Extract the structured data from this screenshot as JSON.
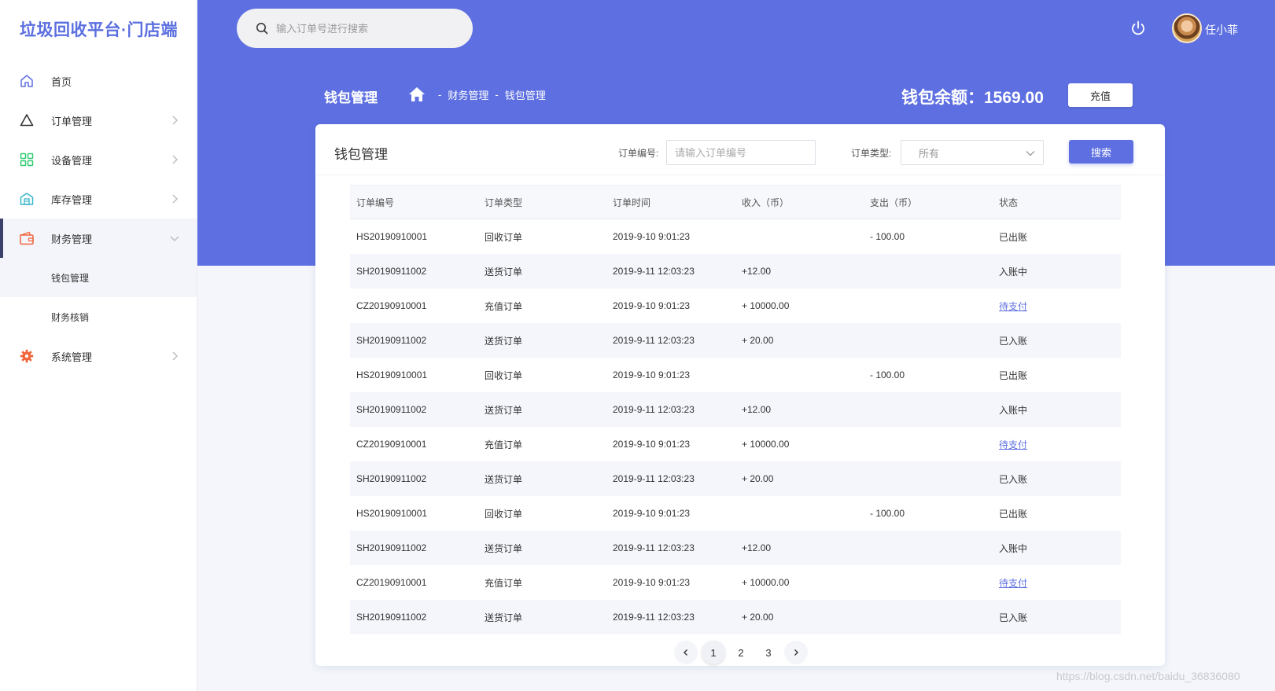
{
  "app": {
    "logo": "垃圾回收平台·门店端"
  },
  "sidebar": {
    "items": [
      {
        "label": "首页",
        "icon": "home-icon",
        "color": "#5e70e1"
      },
      {
        "label": "订单管理",
        "icon": "triangle-icon",
        "color": "#333333"
      },
      {
        "label": "设备管理",
        "icon": "grid-icon",
        "color": "#2ecc71"
      },
      {
        "label": "库存管理",
        "icon": "warehouse-icon",
        "color": "#36b6c9"
      },
      {
        "label": "财务管理",
        "icon": "wallet-icon",
        "color": "#f0653c",
        "expanded": true
      },
      {
        "label": "系统管理",
        "icon": "gear-icon",
        "color": "#f0653c"
      }
    ],
    "sub_items": [
      {
        "label": "钱包管理",
        "active": true
      },
      {
        "label": "财务核销"
      }
    ]
  },
  "header": {
    "search_placeholder": "输入订单号进行搜索",
    "username": "任小菲"
  },
  "page": {
    "title": "钱包管理",
    "breadcrumb": [
      "财务管理",
      "钱包管理"
    ],
    "breadcrumb_sep": "-",
    "balance_label": "钱包余额：",
    "balance_value": "1569.00",
    "recharge_label": "充值"
  },
  "card": {
    "title": "钱包管理",
    "order_no_label": "订单编号:",
    "order_no_placeholder": "请输入订单编号",
    "order_type_label": "订单类型:",
    "order_type_value": "所有",
    "search_label": "搜索"
  },
  "table": {
    "columns": [
      "订单编号",
      "订单类型",
      "订单时间",
      "收入（币）",
      "支出（币）",
      "状态"
    ],
    "rows": [
      [
        "HS20190910001",
        "回收订单",
        "2019-9-10  9:01:23",
        "",
        "- 100.00",
        "已出账"
      ],
      [
        "SH20190911002",
        "送货订单",
        "2019-9-11  12:03:23",
        "+12.00",
        "",
        "入账中"
      ],
      [
        "CZ20190910001",
        "充值订单",
        "2019-9-10  9:01:23",
        "+ 10000.00",
        "",
        "待支付"
      ],
      [
        "SH20190911002",
        "送货订单",
        "2019-9-11  12:03:23",
        "+ 20.00",
        "",
        "已入账"
      ],
      [
        "HS20190910001",
        "回收订单",
        "2019-9-10  9:01:23",
        "",
        "- 100.00",
        "已出账"
      ],
      [
        "SH20190911002",
        "送货订单",
        "2019-9-11  12:03:23",
        "+12.00",
        "",
        "入账中"
      ],
      [
        "CZ20190910001",
        "充值订单",
        "2019-9-10  9:01:23",
        "+ 10000.00",
        "",
        "待支付"
      ],
      [
        "SH20190911002",
        "送货订单",
        "2019-9-11  12:03:23",
        "+ 20.00",
        "",
        "已入账"
      ],
      [
        "HS20190910001",
        "回收订单",
        "2019-9-10  9:01:23",
        "",
        "- 100.00",
        "已出账"
      ],
      [
        "SH20190911002",
        "送货订单",
        "2019-9-11  12:03:23",
        "+12.00",
        "",
        "入账中"
      ],
      [
        "CZ20190910001",
        "充值订单",
        "2019-9-10  9:01:23",
        "+ 10000.00",
        "",
        "待支付"
      ],
      [
        "SH20190911002",
        "送货订单",
        "2019-9-11  12:03:23",
        "+ 20.00",
        "",
        "已入账"
      ]
    ],
    "link_status": "待支付"
  },
  "pagination": {
    "pages": [
      "1",
      "2",
      "3"
    ],
    "current": "1"
  },
  "watermark": "https://blog.csdn.net/baidu_36836080",
  "colors": {
    "brand": "#5e70e1",
    "active_bar": "#3b4169"
  }
}
